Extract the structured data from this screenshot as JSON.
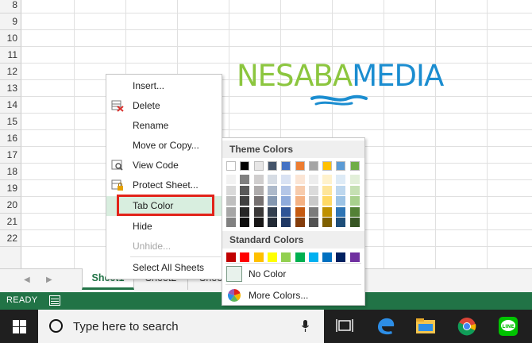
{
  "grid": {
    "row_numbers": [
      "8",
      "9",
      "10",
      "11",
      "12",
      "13",
      "14",
      "15",
      "16",
      "17",
      "18",
      "19",
      "20",
      "21",
      "22"
    ]
  },
  "watermark": {
    "part1": "NESABA",
    "part2": "MEDIA"
  },
  "context_menu": {
    "items": [
      {
        "label": "Insert...",
        "icon": "insert-icon"
      },
      {
        "label": "Delete",
        "icon": "delete-icon"
      },
      {
        "label": "Rename",
        "icon": ""
      },
      {
        "label": "Move or Copy...",
        "icon": ""
      },
      {
        "label": "View Code",
        "icon": "view-code-icon"
      },
      {
        "label": "Protect Sheet...",
        "icon": "protect-sheet-icon"
      },
      {
        "label": "Tab Color",
        "icon": "",
        "highlighted": true
      },
      {
        "label": "Hide",
        "icon": ""
      },
      {
        "label": "Unhide...",
        "icon": "",
        "disabled": true
      },
      {
        "label": "Select All Sheets",
        "icon": ""
      }
    ]
  },
  "palette": {
    "theme_heading": "Theme Colors",
    "standard_heading": "Standard Colors",
    "no_color_label": "No Color",
    "more_colors_label": "More Colors...",
    "theme_columns": [
      [
        "#ffffff",
        "#f2f2f2",
        "#d9d9d9",
        "#bfbfbf",
        "#a6a6a6",
        "#808080"
      ],
      [
        "#000000",
        "#7f7f7f",
        "#595959",
        "#404040",
        "#262626",
        "#0d0d0d"
      ],
      [
        "#e7e6e6",
        "#d0cece",
        "#aeabab",
        "#757070",
        "#3a3838",
        "#171616"
      ],
      [
        "#44546a",
        "#d6dce4",
        "#adb9ca",
        "#8497b0",
        "#333f4f",
        "#222a35"
      ],
      [
        "#4472c4",
        "#d9e2f3",
        "#b4c6e7",
        "#8eaadb",
        "#2f5496",
        "#1f3864"
      ],
      [
        "#ed7d31",
        "#fbe5d5",
        "#f7cbac",
        "#f4b183",
        "#c55a11",
        "#833c0b"
      ],
      [
        "#a5a5a5",
        "#ededed",
        "#dbdbdb",
        "#c9c9c9",
        "#7b7b7b",
        "#525252"
      ],
      [
        "#ffc000",
        "#fff2cc",
        "#fee599",
        "#ffd965",
        "#bf9000",
        "#7f6000"
      ],
      [
        "#5b9bd5",
        "#deebf6",
        "#bdd7ee",
        "#9cc3e5",
        "#2e75b5",
        "#1e4e79"
      ],
      [
        "#70ad47",
        "#e2efd9",
        "#c5e0b3",
        "#a8d08d",
        "#538135",
        "#375623"
      ]
    ],
    "standard_colors": [
      "#c00000",
      "#ff0000",
      "#ffc000",
      "#ffff00",
      "#92d050",
      "#00b050",
      "#00b0f0",
      "#0070c0",
      "#002060",
      "#7030a0"
    ]
  },
  "sheet_tabs": [
    "Sheet1",
    "Sheet2",
    "Shee"
  ],
  "status": {
    "text": "READY"
  },
  "taskbar": {
    "search_placeholder": "Type here to search"
  },
  "colors": {
    "excel_green": "#217346",
    "highlight_red": "#e2231a",
    "hover_green": "#d8eedf"
  }
}
